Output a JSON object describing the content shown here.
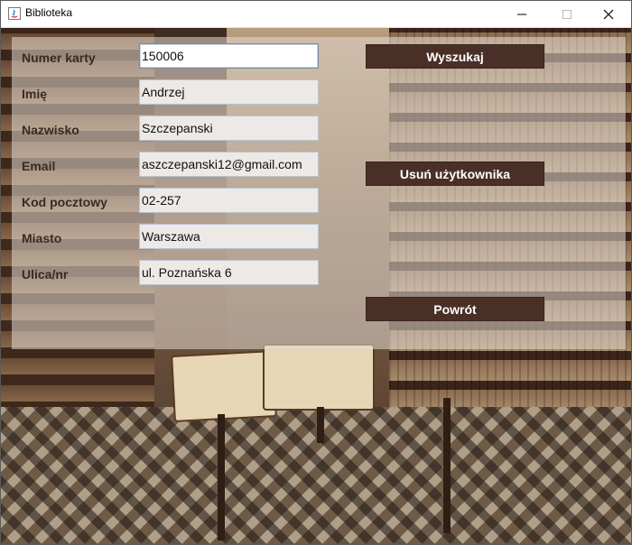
{
  "window": {
    "title": "Biblioteka"
  },
  "form": {
    "fields": [
      {
        "label": "Numer karty",
        "value": "150006"
      },
      {
        "label": "Imię",
        "value": "Andrzej"
      },
      {
        "label": "Nazwisko",
        "value": "Szczepanski"
      },
      {
        "label": "Email",
        "value": "aszczepanski12@gmail.com"
      },
      {
        "label": "Kod pocztowy",
        "value": "02-257"
      },
      {
        "label": "Miasto",
        "value": "Warszawa"
      },
      {
        "label": "Ulica/nr",
        "value": "ul. Poznańska 6"
      }
    ]
  },
  "buttons": {
    "search": "Wyszukaj",
    "delete_user": "Usuń użytkownika",
    "back": "Powrót"
  },
  "colors": {
    "button_bg": "#4a2f27",
    "label_text": "#3a2a22"
  }
}
